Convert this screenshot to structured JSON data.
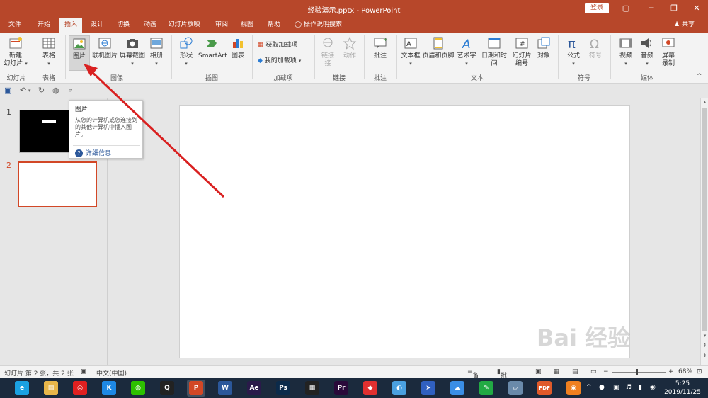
{
  "window": {
    "title": "经验演示.pptx  -  PowerPoint",
    "login_label": "登录",
    "controls": [
      "▢",
      "─",
      "❐",
      "✕"
    ]
  },
  "tabs": [
    {
      "label": "文件"
    },
    {
      "label": "开始"
    },
    {
      "label": "插入",
      "active": true
    },
    {
      "label": "设计"
    },
    {
      "label": "切换"
    },
    {
      "label": "动画"
    },
    {
      "label": "幻灯片放映"
    },
    {
      "label": "审阅"
    },
    {
      "label": "视图"
    },
    {
      "label": "帮助"
    }
  ],
  "tell_me": "操作说明搜索",
  "share_label": "共享",
  "ribbon": {
    "new_slide": "新建",
    "new_slide_2": "幻灯片",
    "table": "表格",
    "picture": "图片",
    "online_picture": "联机图片",
    "screenshot": "屏幕截图",
    "album": "相册",
    "shapes": "形状",
    "smartart": "SmartArt",
    "chart": "图表",
    "get_addins": "获取加载项",
    "my_addins": "我的加载项",
    "link": "链接",
    "link_2": "接",
    "action": "动作",
    "comment": "批注",
    "textbox": "文本框",
    "header_footer": "页眉和页脚",
    "wordart": "艺术字",
    "datetime": "日期和时间",
    "slide_number": "幻灯片",
    "slide_number_2": "编号",
    "object": "对象",
    "equation": "公式",
    "symbol": "符号",
    "video": "视频",
    "audio": "音频",
    "screen_rec": "屏幕",
    "screen_rec_2": "录制",
    "groups": {
      "slides": "幻灯片",
      "tables": "表格",
      "images": "图像",
      "illustrations": "插图",
      "addins": "加载项",
      "links": "链接",
      "comments": "批注",
      "text": "文本",
      "symbols": "符号",
      "media": "媒体"
    }
  },
  "tooltip": {
    "title": "图片",
    "description": "从您的计算机或您连接到的其他计算机中插入图片。",
    "help": "详细信息"
  },
  "thumbnails": {
    "slide1": "1",
    "slide2": "2"
  },
  "statusbar": {
    "slide_info": "幻灯片 第 2 张，共 2 张",
    "language": "中文(中国)",
    "notes": "备注",
    "comments": "批注",
    "zoom": "68%"
  },
  "taskbar": {
    "time": "5:25",
    "date": "2019/11/25",
    "apps": [
      {
        "name": "browser",
        "label": "e",
        "color": "#1ba1e2"
      },
      {
        "name": "explorer",
        "label": "▤",
        "color": "#e8b64a"
      },
      {
        "name": "netease",
        "label": "◎",
        "color": "#e02020"
      },
      {
        "name": "kugou",
        "label": "K",
        "color": "#1e88e5"
      },
      {
        "name": "wechat",
        "label": "◍",
        "color": "#2dc100"
      },
      {
        "name": "qq",
        "label": "Q",
        "color": "#222222"
      },
      {
        "name": "powerpoint",
        "label": "P",
        "color": "#d24726"
      },
      {
        "name": "word",
        "label": "W",
        "color": "#2b579a"
      },
      {
        "name": "aftereffects",
        "label": "Ae",
        "color": "#2a1a4a"
      },
      {
        "name": "photoshop",
        "label": "Ps",
        "color": "#0b2a4a"
      },
      {
        "name": "video-editor",
        "label": "▦",
        "color": "#222222"
      },
      {
        "name": "premiere",
        "label": "Pr",
        "color": "#2a0a3a"
      },
      {
        "name": "app-colorful",
        "label": "◆",
        "color": "#e03030"
      },
      {
        "name": "app-bird",
        "label": "◐",
        "color": "#4aa0e0"
      },
      {
        "name": "app-plane",
        "label": "➤",
        "color": "#3060c0"
      },
      {
        "name": "baidu-netdisk",
        "label": "☁",
        "color": "#3a8ee6"
      },
      {
        "name": "app-green",
        "label": "✎",
        "color": "#22aa44"
      },
      {
        "name": "app-notebook",
        "label": "▱",
        "color": "#6a8aaa"
      },
      {
        "name": "pdf",
        "label": "PDF",
        "color": "#e05a2a"
      },
      {
        "name": "app-orange",
        "label": "◉",
        "color": "#f08020"
      }
    ]
  },
  "watermark": "Bai 经验",
  "colors": {
    "accent": "#b7472a",
    "arrow": "#d92020"
  }
}
